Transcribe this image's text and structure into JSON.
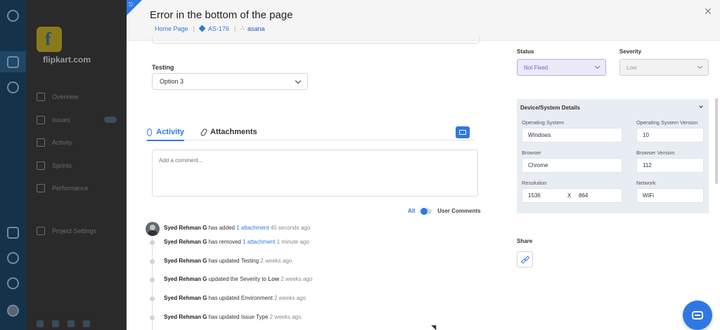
{
  "background": {
    "company_name": "flipkart.com",
    "menu": [
      "Overview",
      "Issues",
      "Activity",
      "Sprints",
      "Performance",
      "Project Settings"
    ],
    "issues_count": "6"
  },
  "header": {
    "title": "Error in the bottom of the page",
    "breadcrumb_home": "Home Page",
    "breadcrumb_issue": "AS-176",
    "breadcrumb_integration": "asana"
  },
  "testing": {
    "label": "Testing",
    "value": "Option 3"
  },
  "tabs": {
    "activity": "Activity",
    "attachments": "Attachments"
  },
  "comment": {
    "placeholder": "Add a comment..."
  },
  "filter": {
    "all": "All",
    "user_comments": "User Comments"
  },
  "activity": [
    {
      "user": "Syed Rehman G",
      "action": "has added",
      "link": "1 attachment",
      "time": "45 seconds ago"
    },
    {
      "user": "Syed Rehman G",
      "action": "has removed",
      "link": "1 attachment",
      "time": "1 minute ago"
    },
    {
      "user": "Syed Rehman G",
      "action": "has updated Testing",
      "time": "2 weeks ago"
    },
    {
      "user": "Syed Rehman G",
      "action": "updated the Severity to",
      "value": "Low",
      "time": "2 weeks ago"
    },
    {
      "user": "Syed Rehman G",
      "action": "has updated Environment",
      "time": "2 weeks ago"
    },
    {
      "user": "Syed Rehman G",
      "action": "has updated Issue Type",
      "time": "2 weeks ago"
    }
  ],
  "status": {
    "label": "Status",
    "value": "Not Fixed"
  },
  "severity": {
    "label": "Severity",
    "value": "Low"
  },
  "device": {
    "title": "Device/System Details",
    "os_label": "Operating System",
    "os_value": "Windows",
    "os_version_label": "Operating System Version",
    "os_version_value": "10",
    "browser_label": "Browser",
    "browser_value": "Chrome",
    "browser_version_label": "Browser Version",
    "browser_version_value": "112",
    "resolution_label": "Resolution",
    "resolution_width": "1536",
    "resolution_x": "X",
    "resolution_height": "864",
    "network_label": "Network",
    "network_value": "WiFi"
  },
  "share": {
    "label": "Share"
  },
  "colors": {
    "accent": "#2f78e4",
    "status_bg": "#ece9f8",
    "status_text": "#6f63b8",
    "device_panel_bg": "#e8edf4"
  }
}
